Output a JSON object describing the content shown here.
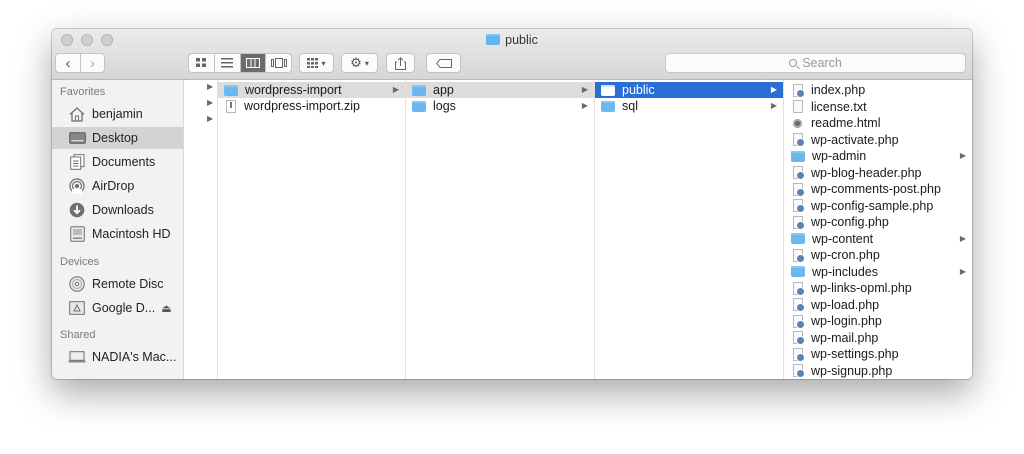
{
  "window": {
    "title": "public"
  },
  "toolbar": {
    "back_icon": "‹",
    "forward_icon": "›",
    "search_placeholder": "Search"
  },
  "sidebar": {
    "favorites_header": "Favorites",
    "favorites": [
      {
        "label": "benjamin",
        "icon": "home-icon"
      },
      {
        "label": "Desktop",
        "icon": "desktop-icon",
        "selected": true
      },
      {
        "label": "Documents",
        "icon": "documents-icon"
      },
      {
        "label": "AirDrop",
        "icon": "airdrop-icon"
      },
      {
        "label": "Downloads",
        "icon": "downloads-icon"
      },
      {
        "label": "Macintosh HD",
        "icon": "disk-icon"
      }
    ],
    "devices_header": "Devices",
    "devices": [
      {
        "label": "Remote Disc",
        "icon": "disc-icon"
      },
      {
        "label": "Google D...",
        "icon": "drive-icon",
        "eject": "⏏"
      }
    ],
    "shared_header": "Shared",
    "shared": [
      {
        "label": "NADIA's Mac...",
        "icon": "computer-icon"
      }
    ]
  },
  "columns": {
    "col1": [
      {
        "name": "wordpress-import",
        "type": "folder",
        "expanded": true
      },
      {
        "name": "wordpress-import.zip",
        "type": "zip"
      }
    ],
    "col2": [
      {
        "name": "app",
        "type": "folder",
        "expanded": true
      },
      {
        "name": "logs",
        "type": "folder"
      }
    ],
    "col3": [
      {
        "name": "public",
        "type": "folder",
        "selected": true
      },
      {
        "name": "sql",
        "type": "folder"
      }
    ],
    "col4": [
      {
        "name": "index.php",
        "type": "php"
      },
      {
        "name": "license.txt",
        "type": "txt"
      },
      {
        "name": "readme.html",
        "type": "html"
      },
      {
        "name": "wp-activate.php",
        "type": "php"
      },
      {
        "name": "wp-admin",
        "type": "folder"
      },
      {
        "name": "wp-blog-header.php",
        "type": "php"
      },
      {
        "name": "wp-comments-post.php",
        "type": "php"
      },
      {
        "name": "wp-config-sample.php",
        "type": "php"
      },
      {
        "name": "wp-config.php",
        "type": "php"
      },
      {
        "name": "wp-content",
        "type": "folder"
      },
      {
        "name": "wp-cron.php",
        "type": "php"
      },
      {
        "name": "wp-includes",
        "type": "folder"
      },
      {
        "name": "wp-links-opml.php",
        "type": "php"
      },
      {
        "name": "wp-load.php",
        "type": "php"
      },
      {
        "name": "wp-login.php",
        "type": "php"
      },
      {
        "name": "wp-mail.php",
        "type": "php"
      },
      {
        "name": "wp-settings.php",
        "type": "php"
      },
      {
        "name": "wp-signup.php",
        "type": "php"
      }
    ]
  },
  "colors": {
    "selection": "#2a6fd6",
    "folder": "#6bb8f0"
  }
}
